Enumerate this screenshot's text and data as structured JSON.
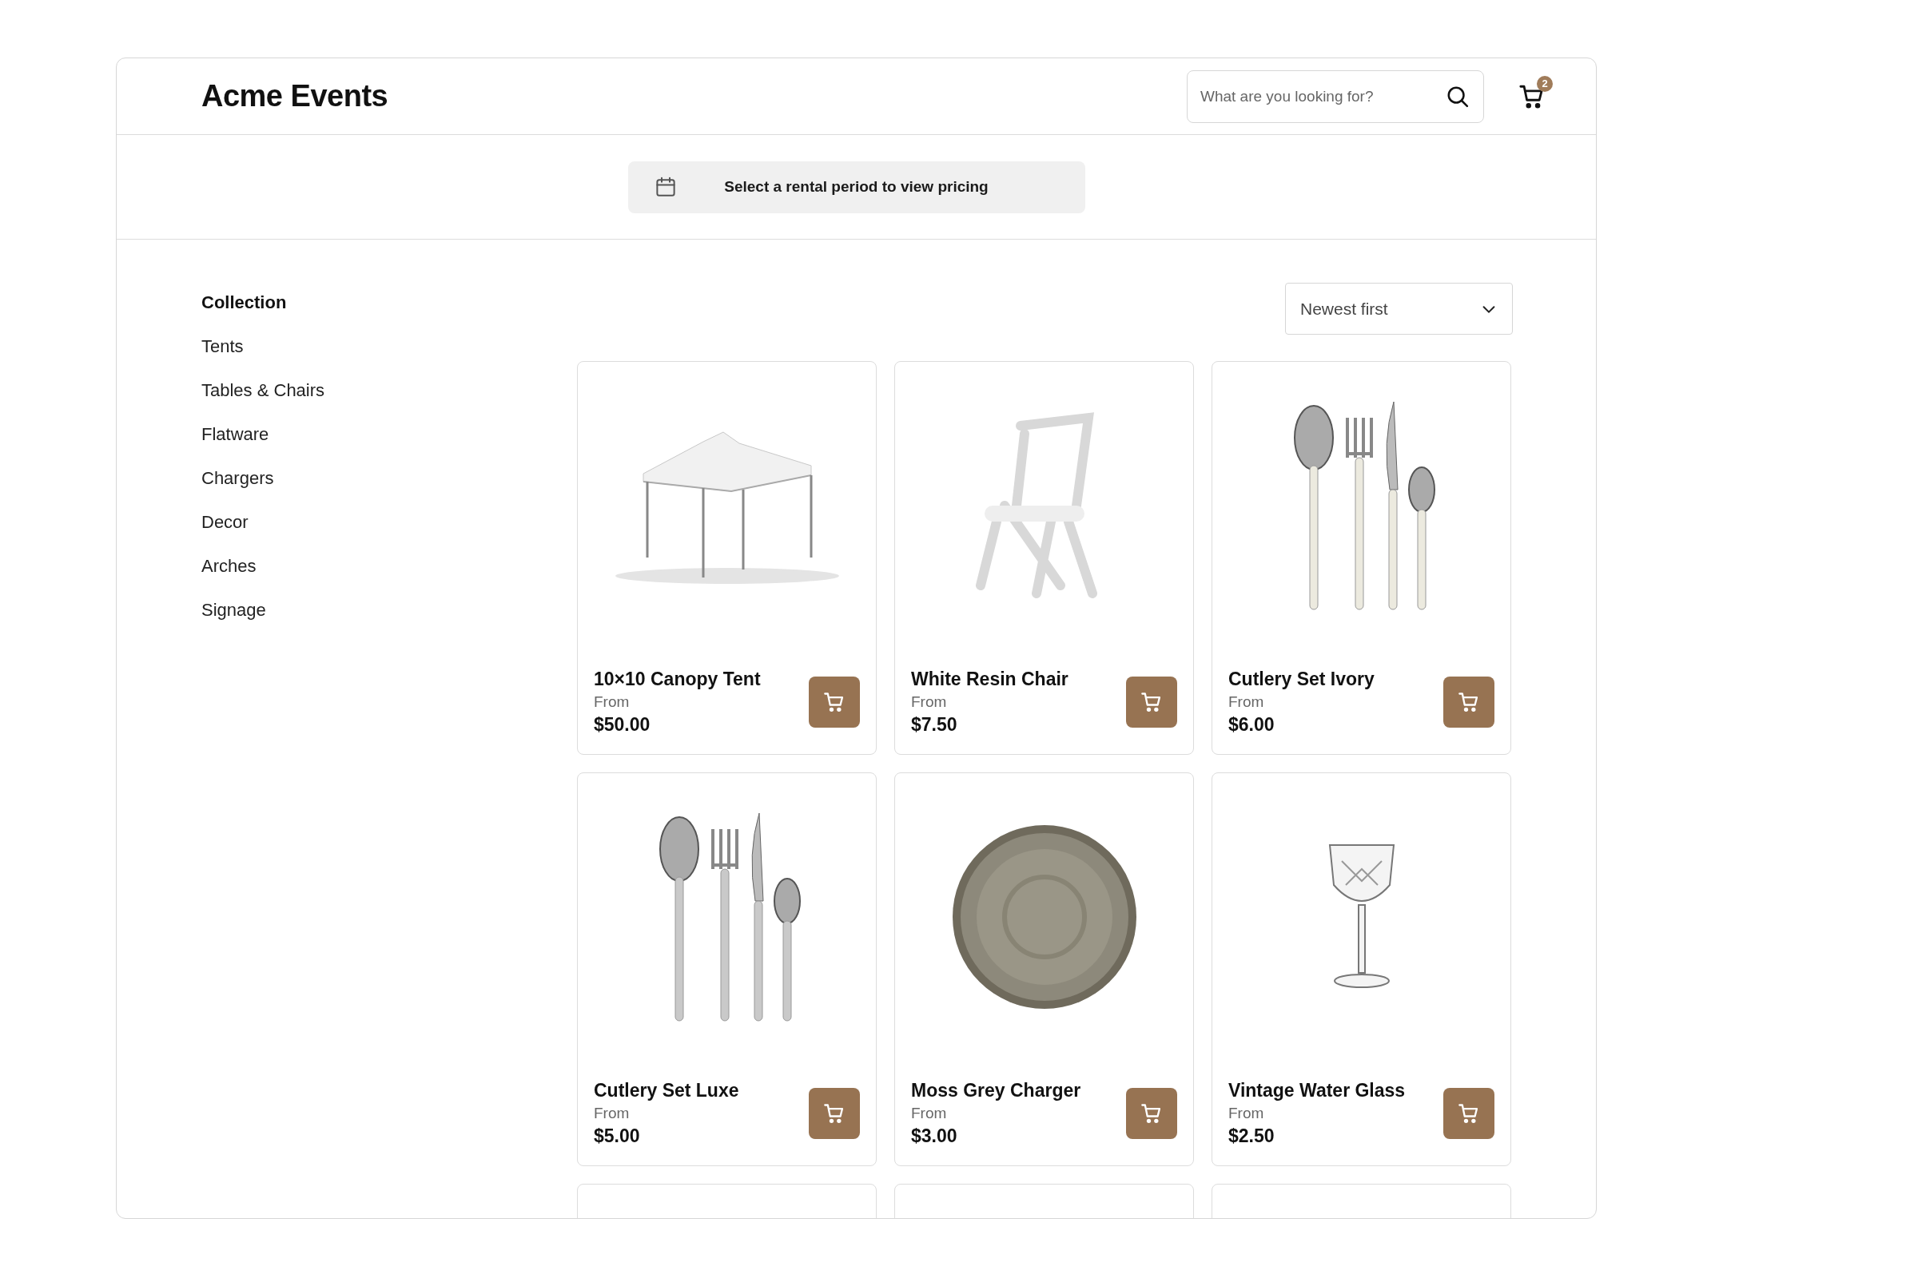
{
  "header": {
    "brand": "Acme Events",
    "search": {
      "placeholder": "What are you looking for?"
    },
    "cart_count": "2"
  },
  "banner": {
    "text": "Select a rental period to view pricing"
  },
  "sidebar": {
    "heading": "Collection",
    "items": [
      {
        "label": "Tents"
      },
      {
        "label": "Tables & Chairs"
      },
      {
        "label": "Flatware"
      },
      {
        "label": "Chargers"
      },
      {
        "label": "Decor"
      },
      {
        "label": "Arches"
      },
      {
        "label": "Signage"
      }
    ]
  },
  "sort": {
    "value": "Newest first"
  },
  "products": [
    {
      "kind": "product",
      "name": "10×10 Canopy Tent",
      "from": "From",
      "price": "$50.00"
    },
    {
      "kind": "product",
      "name": "White Resin Chair",
      "from": "From",
      "price": "$7.50"
    },
    {
      "kind": "product",
      "name": "Cutlery Set Ivory",
      "from": "From",
      "price": "$6.00"
    },
    {
      "kind": "product",
      "name": "Cutlery Set Luxe",
      "from": "From",
      "price": "$5.00"
    },
    {
      "kind": "product",
      "name": "Moss Grey Charger",
      "from": "From",
      "price": "$3.00"
    },
    {
      "kind": "product",
      "name": "Vintage Water Glass",
      "from": "From",
      "price": "$2.50"
    },
    {
      "kind": "cut_off"
    },
    {
      "kind": "cut_off"
    },
    {
      "kind": "cut_off"
    }
  ]
}
